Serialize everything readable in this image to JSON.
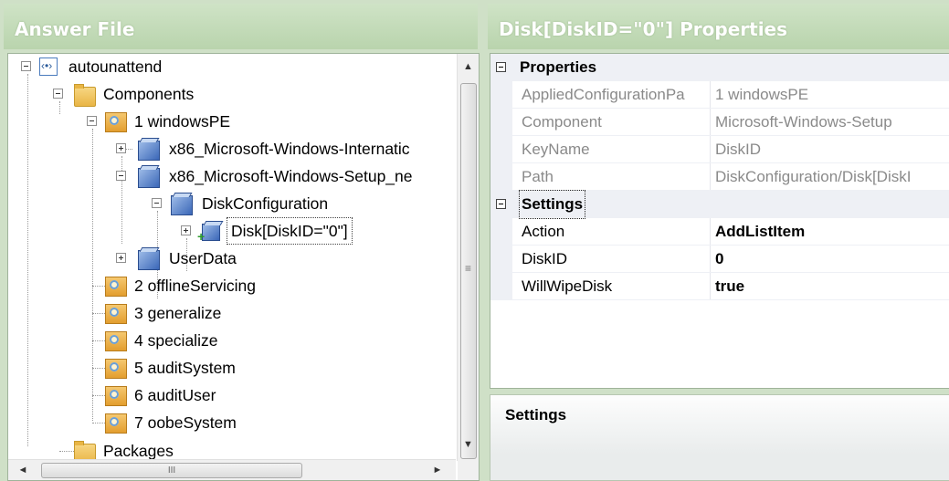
{
  "left_pane": {
    "title": "Answer File",
    "tree": {
      "root": "autounattend",
      "components": "Components",
      "pass1": "1 windowsPE",
      "comp_intl": "x86_Microsoft-Windows-Internatic",
      "comp_setup": "x86_Microsoft-Windows-Setup_ne",
      "disk_configuration": "DiskConfiguration",
      "disk": "Disk[DiskID=\"0\"]",
      "user_data": "UserData",
      "pass2": "2 offlineServicing",
      "pass3": "3 generalize",
      "pass4": "4 specialize",
      "pass5": "5 auditSystem",
      "pass6": "6 auditUser",
      "pass7": "7 oobeSystem",
      "packages": "Packages"
    },
    "scroll": {
      "up": "▲",
      "down": "▼",
      "left": "◄",
      "right": "►",
      "grip": "≡",
      "hgrip": "III"
    }
  },
  "right_pane": {
    "title": "Disk[DiskID=\"0\"] Properties",
    "categories": {
      "properties": "Properties",
      "settings": "Settings"
    },
    "properties": [
      {
        "name": "AppliedConfigurationPa",
        "value": "1 windowsPE"
      },
      {
        "name": "Component",
        "value": "Microsoft-Windows-Setup"
      },
      {
        "name": "KeyName",
        "value": "DiskID"
      },
      {
        "name": "Path",
        "value": "DiskConfiguration/Disk[DiskI"
      }
    ],
    "settings": [
      {
        "name": "Action",
        "value": "AddListItem"
      },
      {
        "name": "DiskID",
        "value": "0"
      },
      {
        "name": "WillWipeDisk",
        "value": "true"
      }
    ],
    "description_title": "Settings"
  },
  "icons": {
    "root": "answer-file-icon",
    "folder": "folder-icon",
    "pass": "configuration-pass-icon",
    "component": "component-cube-icon",
    "list_item": "list-item-add-icon"
  }
}
